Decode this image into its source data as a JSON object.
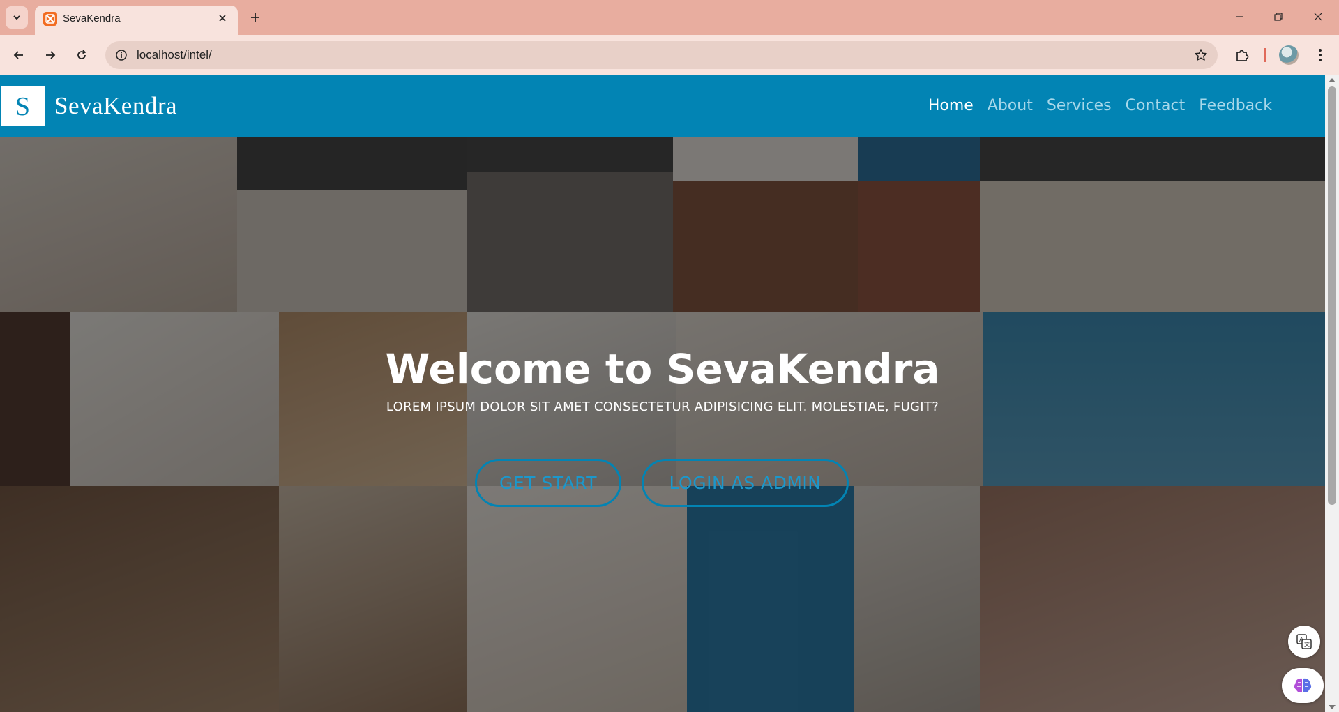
{
  "browser": {
    "tab": {
      "title": "SevaKendra",
      "favicon": "xampp-icon"
    },
    "address": {
      "url": "localhost/intel/"
    },
    "icons": {
      "tab_search": "chevron-down-icon",
      "new_tab": "plus-icon",
      "back": "arrow-left-icon",
      "forward": "arrow-right-icon",
      "reload": "reload-icon",
      "site_info": "info-icon",
      "bookmark": "star-icon",
      "extensions": "puzzle-icon",
      "menu": "kebab-menu-icon"
    },
    "colors": {
      "tabbar": "#e8ad9f",
      "toolbar": "#f8e3dd"
    }
  },
  "site": {
    "logo_letter": "S",
    "brand": "SevaKendra",
    "nav": [
      {
        "label": "Home",
        "active": true
      },
      {
        "label": "About",
        "active": false
      },
      {
        "label": "Services",
        "active": false
      },
      {
        "label": "Contact",
        "active": false
      },
      {
        "label": "Feedback",
        "active": false
      }
    ],
    "colors": {
      "primary": "#0284b4",
      "nav_inactive": "#a8d8ea"
    }
  },
  "hero": {
    "title": "Welcome to SevaKendra",
    "subtitle": "LOREM IPSUM DOLOR SIT AMET CONSECTETUR ADIPISICING ELIT. MOLESTIAE, FUGIT?",
    "buttons": {
      "start": "GET START",
      "admin": "LOGIN AS ADMIN"
    }
  },
  "floating": {
    "translate": "translate-icon",
    "assistant": "brain-icon"
  }
}
